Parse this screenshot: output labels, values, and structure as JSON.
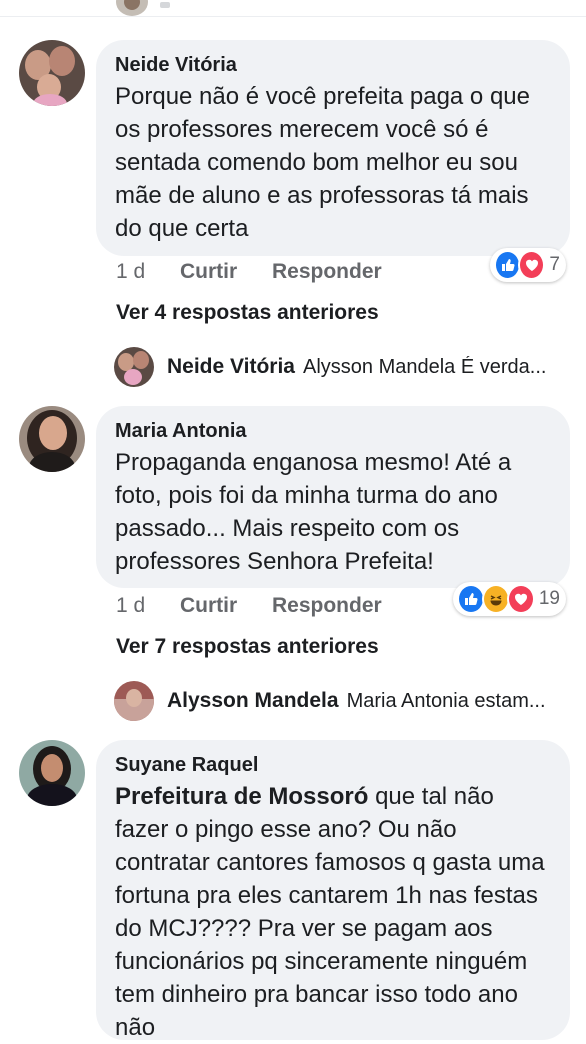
{
  "comments": [
    {
      "author": "Neide Vitória",
      "text": "Porque não é você prefeita paga o que os professores merecem você só é sentada comendo bom melhor eu sou mãe de aluno e as professoras tá mais do que certa",
      "time": "1 d",
      "like_label": "Curtir",
      "reply_label": "Responder",
      "reactions": [
        "like",
        "love"
      ],
      "reaction_count": "7",
      "view_previous": "Ver 4 respostas anteriores",
      "latest_reply": {
        "author": "Neide Vitória",
        "preview": "Alysson Mandela É verda..."
      }
    },
    {
      "author": "Maria Antonia",
      "text": "Propaganda enganosa mesmo! Até a foto, pois foi da minha turma do ano passado... Mais respeito com os professores Senhora Prefeita!",
      "time": "1 d",
      "like_label": "Curtir",
      "reply_label": "Responder",
      "reactions": [
        "like",
        "haha",
        "love"
      ],
      "reaction_count": "19",
      "view_previous": "Ver 7 respostas anteriores",
      "latest_reply": {
        "author": "Alysson Mandela",
        "preview": "Maria Antonia estam..."
      }
    },
    {
      "author": "Suyane Raquel",
      "mention": "Prefeitura de Mossoró",
      "text": " que tal não fazer o pingo esse ano? Ou não contratar cantores famosos q gasta uma fortuna pra eles cantarem 1h nas festas do MCJ???? Pra ver se pagam aos funcionários  pq sinceramente ninguém tem dinheiro pra bancar isso todo ano não"
    }
  ],
  "colors": {
    "bubble": "#f0f2f5",
    "like_blue": "#1877f2",
    "love_red": "#f33e58",
    "haha_yellow": "#f7b125",
    "meta_gray": "#65676b"
  }
}
